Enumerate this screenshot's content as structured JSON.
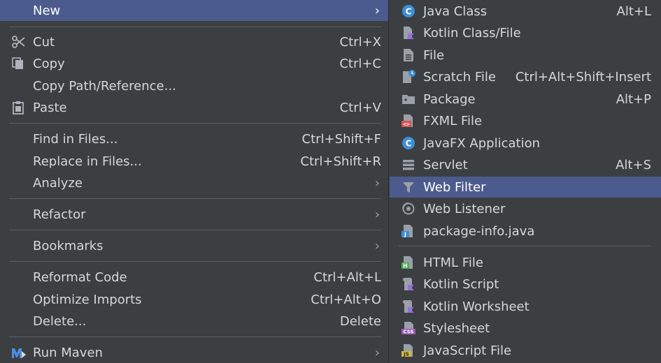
{
  "main_menu": {
    "new": {
      "label": "New"
    },
    "cut": {
      "label": "Cut",
      "shortcut": "Ctrl+X"
    },
    "copy": {
      "label": "Copy",
      "shortcut": "Ctrl+C"
    },
    "copy_path": {
      "label": "Copy Path/Reference..."
    },
    "paste": {
      "label": "Paste",
      "shortcut": "Ctrl+V"
    },
    "find_in_files": {
      "label": "Find in Files...",
      "shortcut": "Ctrl+Shift+F"
    },
    "replace_in_files": {
      "label": "Replace in Files...",
      "shortcut": "Ctrl+Shift+R"
    },
    "analyze": {
      "label": "Analyze"
    },
    "refactor": {
      "label": "Refactor"
    },
    "bookmarks": {
      "label": "Bookmarks"
    },
    "reformat_code": {
      "label": "Reformat Code",
      "shortcut": "Ctrl+Alt+L"
    },
    "optimize_imports": {
      "label": "Optimize Imports",
      "shortcut": "Ctrl+Alt+O"
    },
    "delete": {
      "label": "Delete...",
      "shortcut": "Delete"
    },
    "run_maven": {
      "label": "Run Maven"
    },
    "submenu_arrow": "›"
  },
  "new_submenu": {
    "java_class": {
      "label": "Java Class",
      "shortcut": "Alt+L",
      "icon": "java-class-icon"
    },
    "kotlin_class": {
      "label": "Kotlin Class/File",
      "icon": "kotlin-file-icon"
    },
    "file": {
      "label": "File",
      "icon": "file-icon"
    },
    "scratch_file": {
      "label": "Scratch File",
      "shortcut": "Ctrl+Alt+Shift+Insert",
      "icon": "scratch-file-icon"
    },
    "package": {
      "label": "Package",
      "shortcut": "Alt+P",
      "icon": "folder-icon"
    },
    "fxml_file": {
      "label": "FXML File",
      "icon": "fxml-file-icon"
    },
    "javafx_app": {
      "label": "JavaFX Application",
      "icon": "javafx-class-icon"
    },
    "servlet": {
      "label": "Servlet",
      "shortcut": "Alt+S",
      "icon": "servlet-icon"
    },
    "web_filter": {
      "label": "Web Filter",
      "icon": "filter-icon"
    },
    "web_listener": {
      "label": "Web Listener",
      "icon": "listener-icon"
    },
    "package_info": {
      "label": "package-info.java",
      "icon": "java-file-icon"
    },
    "html_file": {
      "label": "HTML File",
      "icon": "html-file-icon"
    },
    "kotlin_script": {
      "label": "Kotlin Script",
      "icon": "kotlin-script-icon"
    },
    "kotlin_worksheet": {
      "label": "Kotlin Worksheet",
      "icon": "kotlin-worksheet-icon"
    },
    "stylesheet": {
      "label": "Stylesheet",
      "icon": "css-file-icon"
    },
    "javascript_file": {
      "label": "JavaScript File",
      "icon": "js-file-icon"
    }
  },
  "icon_text": {
    "class_letter": "C",
    "html_letter": "H",
    "css_text": "CSS",
    "js_text": "JS",
    "java_letter": "J",
    "fxml_text": "<>"
  },
  "colors": {
    "background": "#3c3f41",
    "selection": "#4c5b8d",
    "separator": "#5a5d63",
    "class_icon": "#3d8ed8",
    "kotlin": "#9b6ce0"
  }
}
